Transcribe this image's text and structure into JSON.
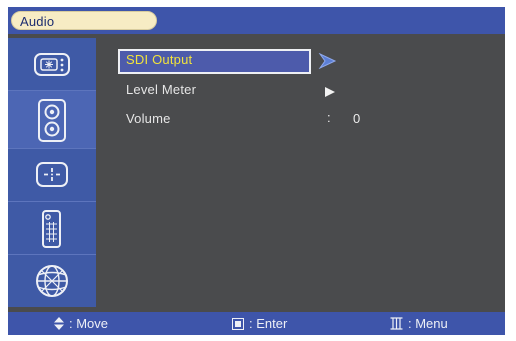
{
  "header": {
    "title": "Audio"
  },
  "sidebar": {
    "items": [
      {
        "icon": "picture-icon",
        "selected": false
      },
      {
        "icon": "speaker-icon",
        "selected": true
      },
      {
        "icon": "position-icon",
        "selected": false
      },
      {
        "icon": "remote-control-icon",
        "selected": false
      },
      {
        "icon": "globe-icon",
        "selected": false
      }
    ]
  },
  "menu": {
    "items": [
      {
        "label": "SDI Output",
        "selected": true
      },
      {
        "label": "Level Meter",
        "selected": false
      },
      {
        "label": "Volume",
        "value": "0",
        "separator": ":"
      }
    ]
  },
  "footer": {
    "move_label": ": Move",
    "enter_label": ": Enter",
    "menu_label": ": Menu"
  },
  "colors": {
    "panel": "#4a4b4d",
    "bar": "#3e55aa",
    "highlight_text": "#f1e33c",
    "title_pill": "#f7ecc4"
  }
}
